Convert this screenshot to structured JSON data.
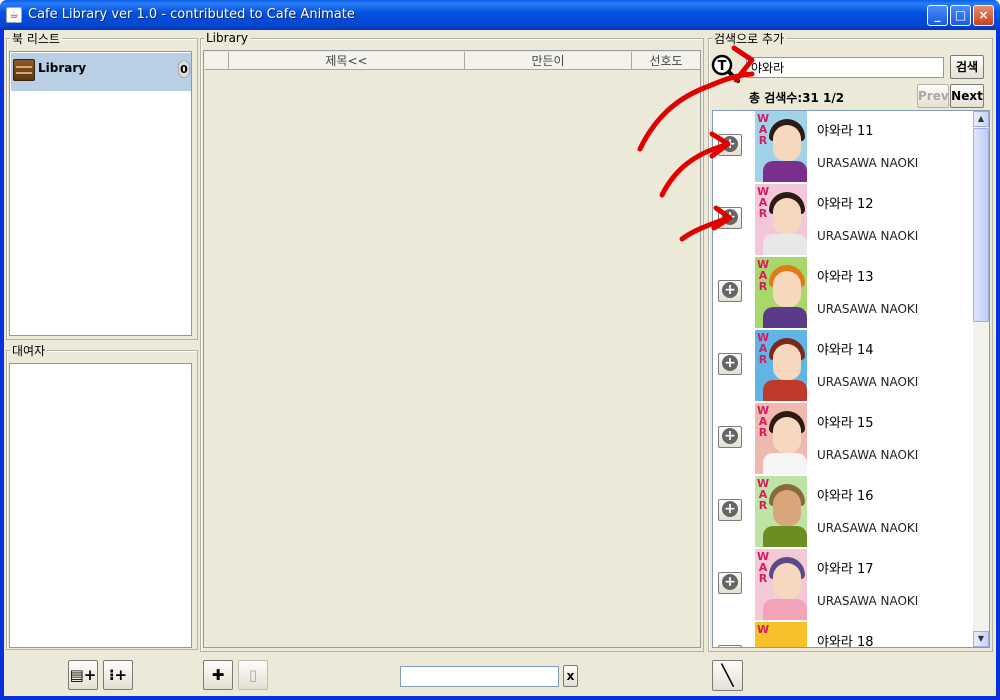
{
  "window": {
    "title": "Cafe Library ver 1.0 - contributed to Cafe Animate",
    "minimize": "_",
    "maximize": "□",
    "close": "×"
  },
  "booklist": {
    "label": "북 리스트",
    "item_label": "Library",
    "item_count": "0"
  },
  "borrower": {
    "label": "대여자"
  },
  "library": {
    "label": "Library",
    "columns": [
      "",
      "제목<<",
      "만든이",
      "선호도"
    ]
  },
  "bottom": {
    "add_book_icon": "▤+",
    "add_person_icon": "⁝+",
    "add_icon": "✚",
    "card_icon": "▯",
    "filter_value": "",
    "clear_label": "x",
    "pen_icon": "╲"
  },
  "search": {
    "label": "검색으로 추가",
    "query": "야와라",
    "button": "검색",
    "total": "총 검색수:31 1/2",
    "prev": "Prev",
    "next": "Next",
    "results": [
      {
        "title": "야와라 11",
        "author": "URASAWA NAOKI"
      },
      {
        "title": "야와라 12",
        "author": "URASAWA NAOKI"
      },
      {
        "title": "야와라 13",
        "author": "URASAWA NAOKI"
      },
      {
        "title": "야와라 14",
        "author": "URASAWA NAOKI"
      },
      {
        "title": "야와라 15",
        "author": "URASAWA NAOKI"
      },
      {
        "title": "야와라 16",
        "author": "URASAWA NAOKI"
      },
      {
        "title": "야와라 17",
        "author": "URASAWA NAOKI"
      },
      {
        "title": "야와라 18",
        "author": ""
      }
    ]
  },
  "colors": {
    "annotation": "#e00000",
    "selection": "#b8cfe5",
    "titlebar": "#0554e3"
  }
}
